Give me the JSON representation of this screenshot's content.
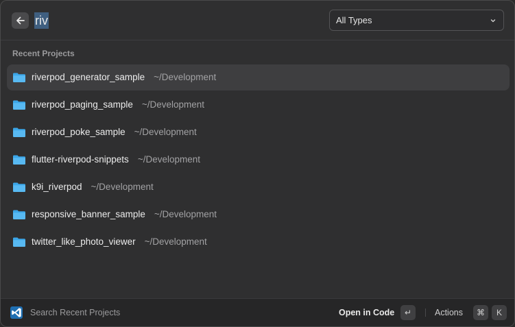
{
  "search": {
    "query": "riv"
  },
  "filter": {
    "selected": "All Types"
  },
  "section": {
    "title": "Recent Projects"
  },
  "projects": [
    {
      "name": "riverpod_generator_sample",
      "path": "~/Development"
    },
    {
      "name": "riverpod_paging_sample",
      "path": "~/Development"
    },
    {
      "name": "riverpod_poke_sample",
      "path": "~/Development"
    },
    {
      "name": "flutter-riverpod-snippets",
      "path": "~/Development"
    },
    {
      "name": "k9i_riverpod",
      "path": "~/Development"
    },
    {
      "name": "responsive_banner_sample",
      "path": "~/Development"
    },
    {
      "name": "twitter_like_photo_viewer",
      "path": "~/Development"
    }
  ],
  "footer": {
    "hint": "Search Recent Projects",
    "primary_action": "Open in Code",
    "primary_key": "↵",
    "actions_label": "Actions",
    "actions_keys": [
      "⌘",
      "K"
    ]
  },
  "colors": {
    "folder": "#3ba6e8",
    "vscode": "#2d8fd6",
    "selection": "#3f5f80"
  }
}
